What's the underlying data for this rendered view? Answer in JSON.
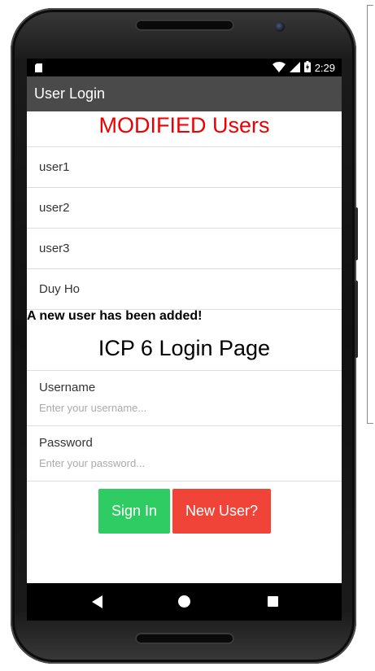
{
  "statusbar": {
    "time": "2:29"
  },
  "appbar": {
    "title": "User Login"
  },
  "users_section": {
    "heading": "MODIFIED Users",
    "heading_color": "#ee0000",
    "users": [
      "user1",
      "user2",
      "user3",
      "Duy Ho"
    ],
    "notice": "A new user has been added!"
  },
  "login": {
    "title": "ICP 6 Login Page",
    "username_label": "Username",
    "username_placeholder": "Enter your username...",
    "password_label": "Password",
    "password_placeholder": "Enter your password...",
    "signin_label": "Sign In",
    "signin_color": "#2ecc63",
    "newuser_label": "New User?",
    "newuser_color": "#f04438"
  },
  "navbar": {
    "icons": [
      "back-icon",
      "home-icon",
      "recent-apps-icon"
    ]
  }
}
